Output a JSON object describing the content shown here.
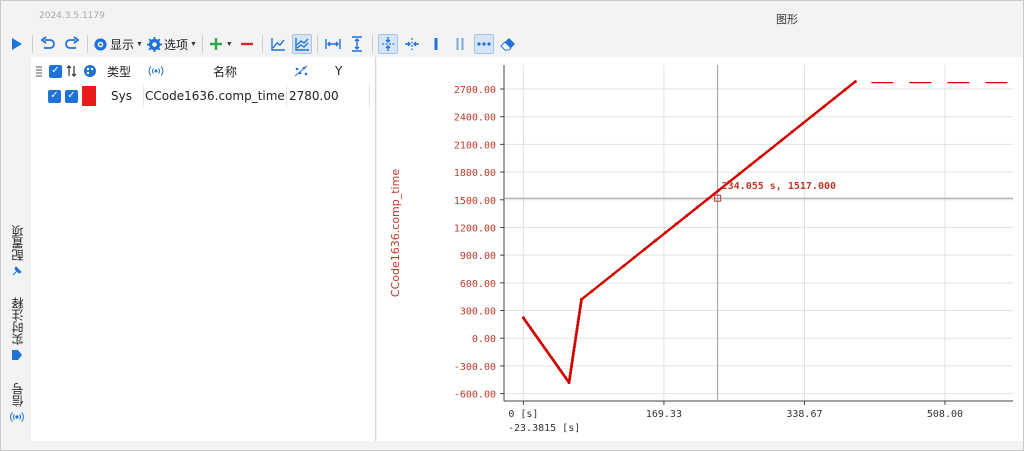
{
  "app": {
    "version": "2024.3.5.1179",
    "graph_title": "图形"
  },
  "toolbar": {
    "display_label": "显示",
    "options_label": "选项"
  },
  "left_tabs": {
    "config": "配置项",
    "annotation": "实时注释",
    "signal": "信号"
  },
  "signal_table": {
    "headers": {
      "type": "类型",
      "name": "名称",
      "y": "Y"
    },
    "rows": [
      {
        "type": "Sys",
        "name": "CCode1636.comp_time",
        "y": "2780.00",
        "color": "#e81c1c"
      }
    ]
  },
  "chart_data": {
    "type": "line",
    "ylabel": "CCode1636.comp_time",
    "xlabel": "",
    "series": [
      {
        "name": "CCode1636.comp_time",
        "color": "#d40000",
        "x": [
          0,
          55,
          70,
          400
        ],
        "y": [
          220,
          -480,
          420,
          2780
        ]
      }
    ],
    "xlim": [
      -23.3815,
      590
    ],
    "ylim": [
      -680,
      2960
    ],
    "yticks": [
      -600,
      -300,
      0,
      300,
      600,
      900,
      1200,
      1500,
      1800,
      2100,
      2400,
      2700
    ],
    "ytick_labels": [
      "-600.00",
      "-300.00",
      "0.00",
      "300.00",
      "600.00",
      "900.00",
      "1200.00",
      "1500.00",
      "1800.00",
      "2100.00",
      "2400.00",
      "2700.00"
    ],
    "xticks": [
      0,
      169.33,
      338.67,
      508.0
    ],
    "xtick_labels": [
      "0 [s]",
      "169.33",
      "338.67",
      "508.00"
    ],
    "x_origin_label": "-23.3815 [s]",
    "cursor": {
      "x": 234.055,
      "y": 1517,
      "label": "234.055 s, 1517.000"
    },
    "grid": true
  }
}
